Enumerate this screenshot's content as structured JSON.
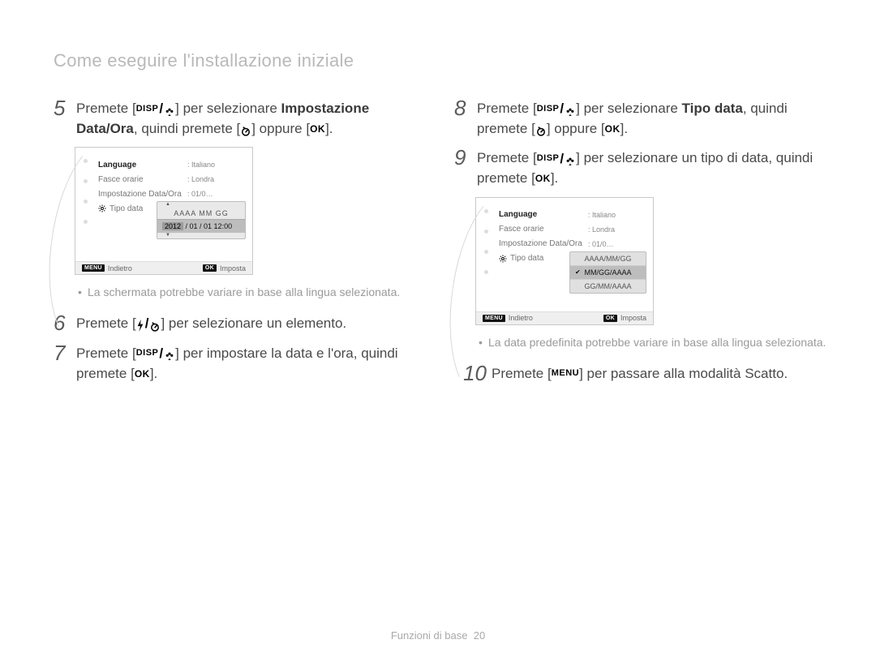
{
  "title": "Come eseguire l'installazione iniziale",
  "steps": {
    "5": {
      "pre": "Premete [",
      "post1": "] per selezionare ",
      "bold": "Impostazione Data/Ora",
      "post2": ", quindi premete [",
      "post3": "] oppure [",
      "post4": "]."
    },
    "6": {
      "pre": "Premete [",
      "post1": "] per selezionare un elemento."
    },
    "7": {
      "pre": "Premete [",
      "post1": "] per impostare la data e l'ora, quindi premete [",
      "post2": "]."
    },
    "8": {
      "pre": "Premete [",
      "post1": "] per selezionare ",
      "bold": "Tipo data",
      "post2": ", quindi premete [",
      "post3": "] oppure [",
      "post4": "]."
    },
    "9": {
      "pre": "Premete [",
      "post1": "] per selezionare un tipo di data, quindi premete [",
      "post2": "]."
    },
    "10": {
      "pre": "Premete [",
      "post1": "] per passare alla modalità Scatto."
    }
  },
  "icons": {
    "disp": "DISP",
    "ok": "OK",
    "menu": "MENU"
  },
  "shot1": {
    "rows": {
      "language": {
        "label": "Language",
        "value": ": Italiano"
      },
      "fasce": {
        "label": "Fasce orarie",
        "value": ": Londra"
      },
      "imp": {
        "label": "Impostazione Data/Ora",
        "value": ": 01/0…"
      },
      "tipo": {
        "label": "Tipo data"
      }
    },
    "popup": {
      "header": "AAAA  MM  GG",
      "value_hl": "2012",
      "value_rest": " / 01 / 01 12:00"
    },
    "foot": {
      "back": "Indietro",
      "set": "Imposta",
      "menu": "MENU",
      "ok": "OK"
    }
  },
  "shot2": {
    "rows": {
      "language": {
        "label": "Language",
        "value": ": Italiano"
      },
      "fasce": {
        "label": "Fasce orarie",
        "value": ": Londra"
      },
      "imp": {
        "label": "Impostazione Data/Ora",
        "value": ": 01/0…"
      },
      "tipo": {
        "label": "Tipo data"
      }
    },
    "popup": {
      "opt1": "AAAA/MM/GG",
      "opt2": "MM/GG/AAAA",
      "opt3": "GG/MM/AAAA"
    },
    "foot": {
      "back": "Indietro",
      "set": "Imposta",
      "menu": "MENU",
      "ok": "OK"
    }
  },
  "notes": {
    "n1": "La schermata potrebbe variare in base alla lingua selezionata.",
    "n2": "La data predefinita potrebbe variare in base alla lingua selezionata."
  },
  "footer": {
    "section": "Funzioni di base",
    "page": "20"
  }
}
